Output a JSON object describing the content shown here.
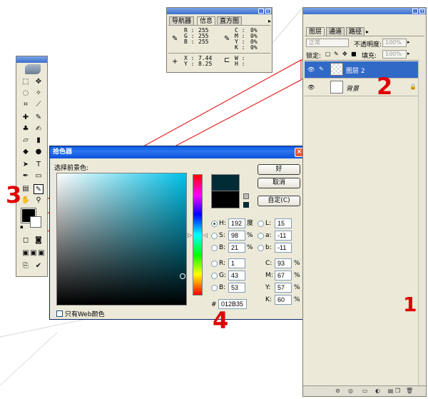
{
  "info_panel": {
    "tabs": [
      "导航器",
      "信息",
      "直方图"
    ],
    "active_tab": "信息",
    "rgb": [
      {
        "label": "R :",
        "value": "255"
      },
      {
        "label": "G :",
        "value": "255"
      },
      {
        "label": "B :",
        "value": "255"
      }
    ],
    "cmyk": [
      {
        "label": "C :",
        "value": "0%"
      },
      {
        "label": "M :",
        "value": "0%"
      },
      {
        "label": "Y :",
        "value": "0%"
      },
      {
        "label": "K :",
        "value": "0%"
      }
    ],
    "xy": [
      {
        "label": "X :",
        "value": "7.44"
      },
      {
        "label": "Y :",
        "value": "8.25"
      }
    ],
    "wh": [
      {
        "label": "W :",
        "value": ""
      },
      {
        "label": "H :",
        "value": ""
      }
    ]
  },
  "picker": {
    "title": "拾色器",
    "prompt": "选择前景色:",
    "buttons": {
      "ok": "好",
      "cancel": "取消",
      "custom": "自定(C)"
    },
    "fields": {
      "H": {
        "label": "H:",
        "value": "192",
        "unit": "度"
      },
      "S": {
        "label": "S:",
        "value": "98",
        "unit": "%"
      },
      "B": {
        "label": "B:",
        "value": "21",
        "unit": "%"
      },
      "R": {
        "label": "R:",
        "value": "1"
      },
      "G": {
        "label": "G:",
        "value": "43"
      },
      "Bl": {
        "label": "B:",
        "value": "53"
      },
      "L": {
        "label": "L:",
        "value": "15"
      },
      "a": {
        "label": "a:",
        "value": "-11"
      },
      "b": {
        "label": "b:",
        "value": "-11"
      },
      "C": {
        "label": "C:",
        "value": "93",
        "unit": "%"
      },
      "M": {
        "label": "M:",
        "value": "67",
        "unit": "%"
      },
      "Y": {
        "label": "Y:",
        "value": "57",
        "unit": "%"
      },
      "K": {
        "label": "K:",
        "value": "60",
        "unit": "%"
      }
    },
    "hex_label": "#",
    "hex": "012B35",
    "web_only": "只有Web颜色",
    "new_color": "#012B35",
    "old_color": "#000000"
  },
  "layers_panel": {
    "tabs": [
      "图层",
      "通道",
      "路径"
    ],
    "active_tab": "图层",
    "blend_mode": "正常",
    "opacity_label": "不透明度:",
    "opacity_value": "100%",
    "lock_label": "锁定:",
    "fill_label": "填充:",
    "fill_value": "100%",
    "layers": [
      {
        "name": "图层 2",
        "selected": true
      },
      {
        "name": "背景",
        "selected": false
      }
    ]
  },
  "annotations": {
    "n1": "1",
    "n2": "2",
    "n3": "3",
    "n4": "4"
  },
  "colors": {
    "annotation": "#e00000",
    "selection": "#3169c6",
    "dialog_title": "#0a5ae0"
  }
}
